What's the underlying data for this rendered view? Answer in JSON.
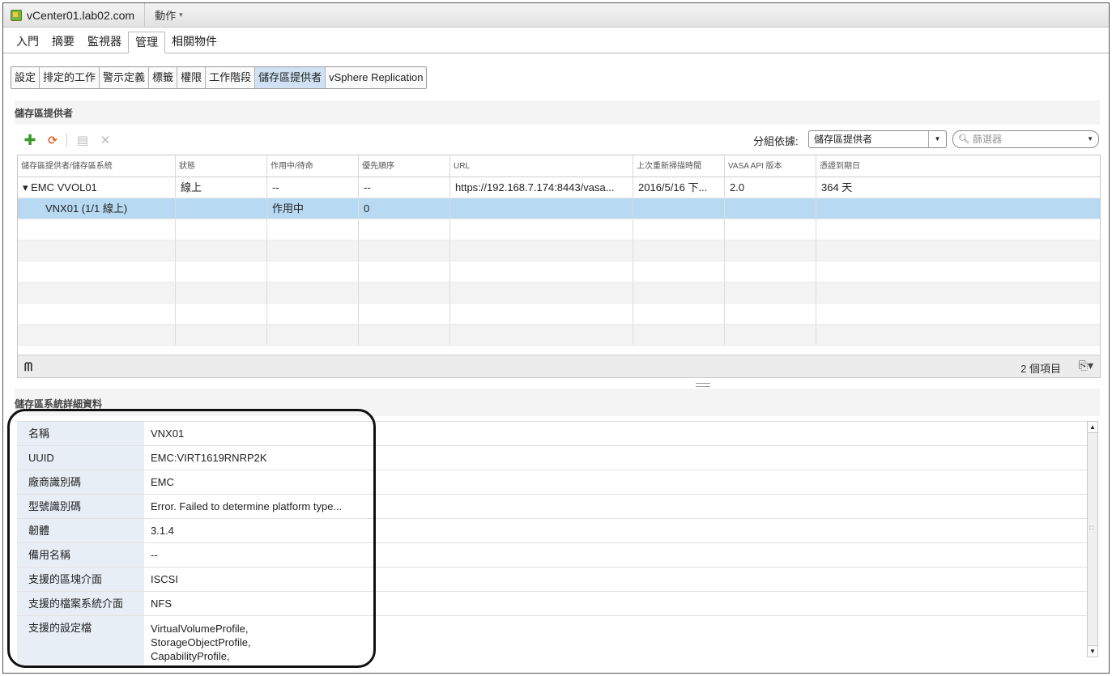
{
  "header": {
    "host_title": "vCenter01.lab02.com",
    "actions_label": "動作",
    "caret": "▾"
  },
  "main_tabs": [
    "入門",
    "摘要",
    "監視器",
    "管理",
    "相關物件"
  ],
  "sub_tabs": [
    "設定",
    "排定的工作",
    "警示定義",
    "標籤",
    "權限",
    "工作階段",
    "儲存區提供者",
    "vSphere Replication"
  ],
  "providers_section": {
    "title": "儲存區提供者",
    "group_by_label": "分組依據:",
    "group_by_value": "儲存區提供者",
    "filter_placeholder": "篩選器"
  },
  "grid": {
    "columns": [
      "儲存區提供者/儲存區系統",
      "狀態",
      "作用中/待命",
      "優先順序",
      "URL",
      "上次重新掃描時間",
      "VASA API 版本",
      "憑證到期日"
    ],
    "rows": [
      [
        "▾  EMC VVOL01",
        "線上",
        "--",
        "--",
        "https://192.168.7.174:8443/vasa...",
        "2016/5/16 下...",
        "2.0",
        "364 天"
      ],
      [
        "VNX01 (1/1 線上)",
        "",
        "作用中",
        "0",
        "",
        "",
        "",
        ""
      ]
    ],
    "item_count": "2 個項目"
  },
  "details_section": {
    "title": "儲存區系統詳細資料",
    "rows": [
      {
        "label": "名稱",
        "value": "VNX01"
      },
      {
        "label": "UUID",
        "value": "EMC:VIRT1619RNRP2K"
      },
      {
        "label": "廠商識別碼",
        "value": "EMC"
      },
      {
        "label": "型號識別碼",
        "value": "Error. Failed to determine platform type..."
      },
      {
        "label": "韌體",
        "value": "3.1.4"
      },
      {
        "label": "備用名稱",
        "value": "--"
      },
      {
        "label": "支援的區塊介面",
        "value": "ISCSI"
      },
      {
        "label": "支援的檔案系統介面",
        "value": "NFS"
      },
      {
        "label": "支援的設定檔",
        "value_lines": [
          "VirtualVolumeProfile,",
          "StorageObjectProfile,",
          "CapabilityProfile,"
        ]
      }
    ]
  },
  "icons": {
    "add": "add-icon",
    "refresh": "refresh-icon",
    "details": "details-icon",
    "remove": "remove-icon",
    "binoculars": "binoculars-icon",
    "export": "export-icon"
  }
}
